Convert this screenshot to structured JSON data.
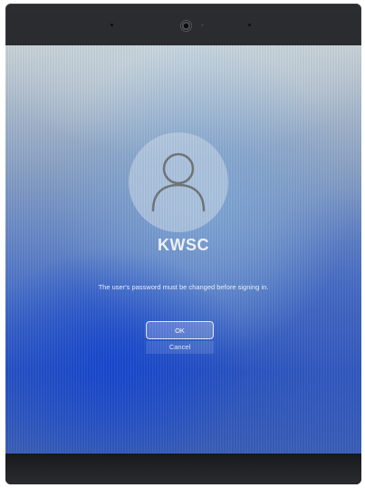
{
  "login_screen": {
    "user_name": "KWSC",
    "message": "The user's password must be changed before signing in.",
    "ok_label": "OK",
    "cancel_label": "Cancel",
    "avatar_icon": "user-silhouette-icon"
  },
  "colors": {
    "screen_blue": "#2a54c2",
    "bezel": "#1b1c1f",
    "text": "#f3f6fb"
  }
}
